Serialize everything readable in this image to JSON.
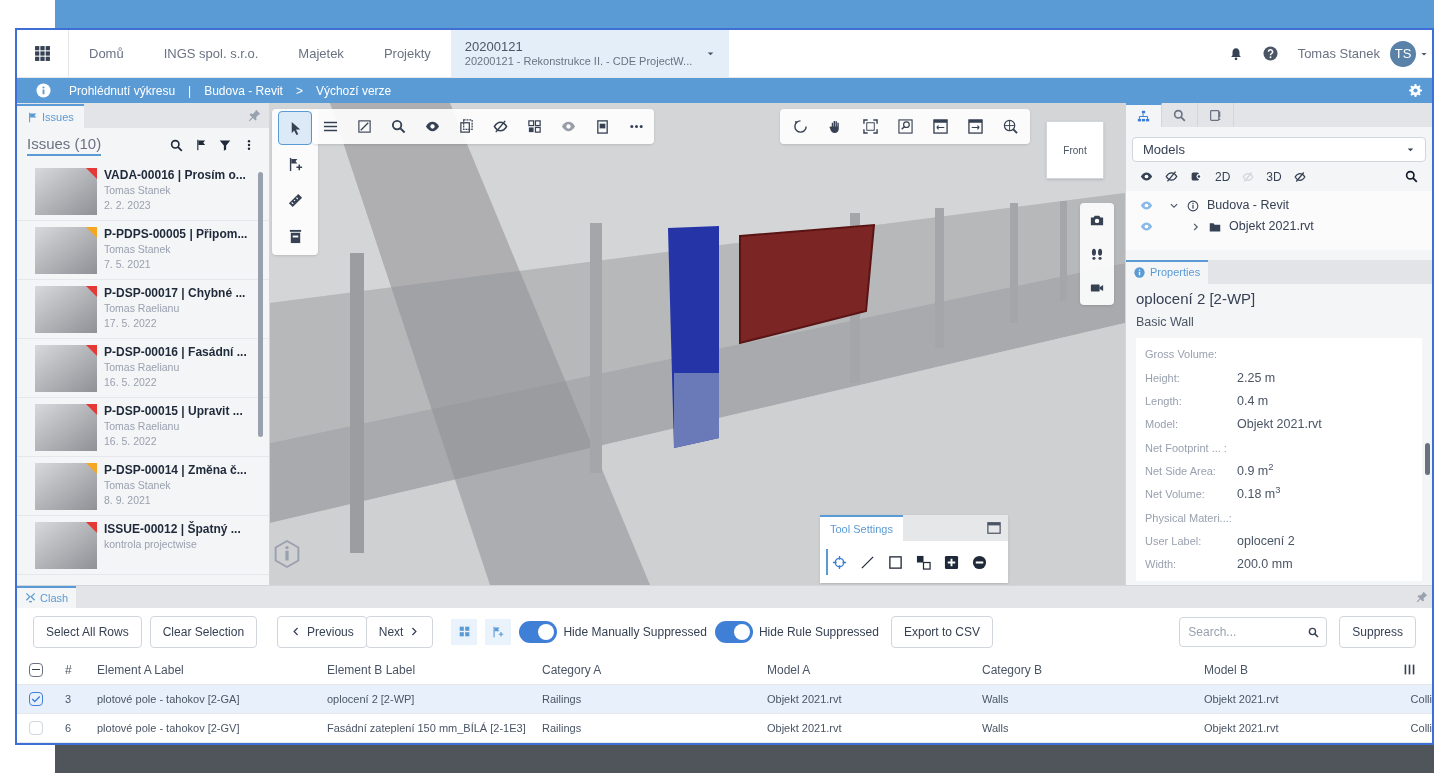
{
  "top_nav": {
    "items": [
      {
        "label": "Domů",
        "selected": false
      },
      {
        "label": "INGS spol. s.r.o.",
        "selected": false
      },
      {
        "label": "Majetek",
        "selected": false
      },
      {
        "label": "Projekty",
        "selected": false
      }
    ],
    "project": {
      "code": "20200121",
      "name": "20200121 - Rekonstrukce II. - CDE ProjectW...",
      "selected": true
    },
    "user": {
      "name": "Tomas Stanek",
      "initials": "TS"
    }
  },
  "breadcrumb": [
    {
      "kind": "link",
      "text": "Prohlédnutí výkresu"
    },
    {
      "kind": "separator",
      "text": "|"
    },
    {
      "kind": "link",
      "text": "Budova - Revit"
    },
    {
      "kind": "separator",
      "text": ">"
    },
    {
      "kind": "link",
      "text": "Výchozí verze"
    }
  ],
  "issues_panel": {
    "tab": "Issues",
    "heading": "Issues (10)",
    "items": [
      {
        "title": "VADA-00016 | Prosím o...",
        "author": "Tomas Stanek",
        "date": "2. 2. 2023",
        "color": "#e53935"
      },
      {
        "title": "P-PDPS-00005 | Připom...",
        "author": "Tomas Stanek",
        "date": "7. 5. 2021",
        "color": "#f5a623"
      },
      {
        "title": "P-DSP-00017 | Chybné ...",
        "author": "Tomas Raelianu",
        "date": "17. 5. 2022",
        "color": "#e53935"
      },
      {
        "title": "P-DSP-00016 | Fasádní ...",
        "author": "Tomas Raelianu",
        "date": "16. 5. 2022",
        "color": "#e53935"
      },
      {
        "title": "P-DSP-00015 | Upravit ...",
        "author": "Tomas Raelianu",
        "date": "16. 5. 2022",
        "color": "#e53935"
      },
      {
        "title": "P-DSP-00014 | Změna č...",
        "author": "Tomas Stanek",
        "date": "8. 9. 2021",
        "color": "#f5a623"
      },
      {
        "title": "ISSUE-00012 | Špatný ...",
        "author": "kontrola projectwise",
        "color": "#e53935"
      }
    ]
  },
  "viewport": {
    "left_tools": [
      {
        "kind": "select",
        "selected": true
      },
      {
        "kind": "issue",
        "selected": false
      },
      {
        "kind": "measure",
        "selected": false
      },
      {
        "kind": "section",
        "selected": false
      }
    ],
    "view_cube": "Front",
    "tool_settings": {
      "tab": "Tool Settings",
      "tools": [
        {
          "kind": "point",
          "selected": true
        },
        {
          "kind": "line",
          "selected": false
        },
        {
          "kind": "box",
          "selected": false
        },
        {
          "kind": "element",
          "selected": false
        },
        {
          "kind": "add",
          "selected": false
        },
        {
          "kind": "remove",
          "selected": false
        }
      ]
    }
  },
  "models_panel": {
    "tabs": [
      {
        "kind": "tree",
        "selected": true
      },
      {
        "kind": "search",
        "selected": false
      },
      {
        "kind": "issues",
        "selected": false
      }
    ],
    "dropdown": "Models",
    "filter_labels": [
      "2D",
      "3D"
    ],
    "tree": [
      {
        "label": "Budova - Revit",
        "kind": "repository",
        "expanded": true,
        "children": [
          {
            "label": "Objekt 2021.rvt",
            "kind": "folder",
            "expanded": false
          }
        ]
      }
    ]
  },
  "properties": {
    "tab": "Properties",
    "title": "oplocení 2 [2-WP]",
    "subtitle": "Basic Wall",
    "rows": [
      {
        "label": "Gross Volume:"
      },
      {
        "label": "Height:",
        "value": "2.25 m"
      },
      {
        "label": "Length:",
        "value": "0.4 m"
      },
      {
        "label": "Model:",
        "value": "Objekt 2021.rvt"
      },
      {
        "label": "Net Footprint ... :"
      },
      {
        "label": "Net Side Area:",
        "value": "0.9 m$^{2}$"
      },
      {
        "label": "Net Volume:",
        "value": "0.18 m$^{3}$"
      },
      {
        "label": "Physical Materi...:"
      },
      {
        "label": "User Label:",
        "value": "oplocení 2"
      },
      {
        "label": "Width:",
        "value": "200.0 mm"
      }
    ]
  },
  "clash_panel": {
    "tab": "Clash",
    "buttons": [
      "Select All Rows",
      "Clear Selection"
    ],
    "previous": "Previous",
    "next": "Next",
    "toggles": [
      {
        "label": "Hide Manually Suppressed",
        "on": true
      },
      {
        "label": "Hide Rule Suppressed",
        "on": true
      }
    ],
    "export": "Export to CSV",
    "search": {
      "placeholder": "Search..."
    },
    "suppress": "Suppress",
    "table": {
      "select_all_partial": true,
      "columns": [
        "#",
        "Element A Label",
        "Element B Label",
        "Category A",
        "Model A",
        "Category B",
        "Model B"
      ],
      "rows": [
        {
          "checked": true,
          "selected": true,
          "cells": [
            "3",
            "plotové pole - tahokov [2-GA]",
            "oplocení 2 [2-WP]",
            "Railings",
            "Objekt 2021.rvt",
            "Walls",
            "Objekt 2021.rvt"
          ],
          "column_9": "Colli"
        },
        {
          "checked": false,
          "selected": false,
          "cells": [
            "6",
            "plotové pole - tahokov [2-GV]",
            "Fasádní zateplení 150 mm_BÍLÁ [2-1E3]",
            "Railings",
            "Objekt 2021.rvt",
            "Walls",
            "Objekt 2021.rvt"
          ],
          "column_9": "Colli"
        }
      ]
    }
  }
}
